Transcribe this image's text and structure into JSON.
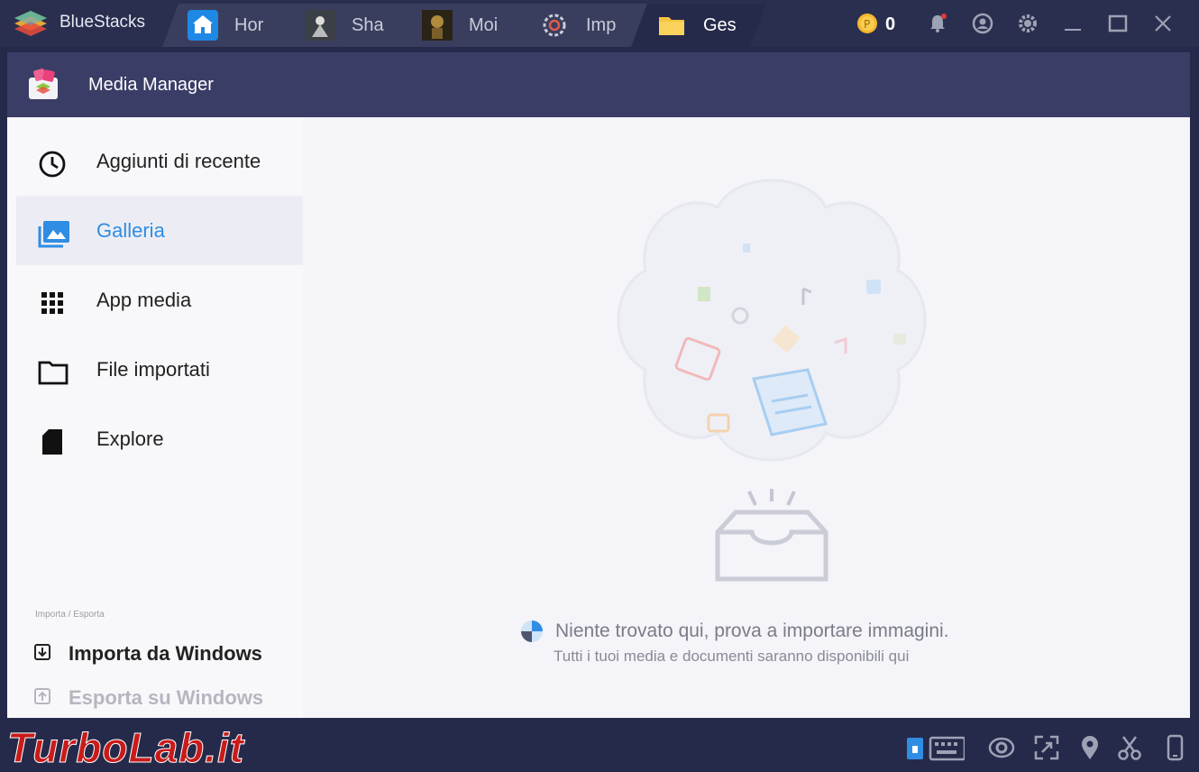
{
  "window": {
    "app_name": "BlueStacks",
    "coin_count": "0",
    "tabs": [
      {
        "label": "Hor",
        "icon": "home-icon"
      },
      {
        "label": "Sha",
        "icon": "game-icon"
      },
      {
        "label": "Moi",
        "icon": "game-icon"
      },
      {
        "label": "Imp",
        "icon": "settings-icon"
      },
      {
        "label": "Ges",
        "icon": "folder-icon"
      }
    ]
  },
  "header": {
    "title": "Media Manager"
  },
  "sidebar": {
    "items": [
      {
        "label": "Aggiunti di recente",
        "icon": "clock-icon"
      },
      {
        "label": "Galleria",
        "icon": "gallery-icon"
      },
      {
        "label": "App media",
        "icon": "grid-icon"
      },
      {
        "label": "File importati",
        "icon": "folder-icon"
      },
      {
        "label": "Explore",
        "icon": "sd-card-icon"
      }
    ],
    "import_export_caption": "Importa / Esporta",
    "import_label": "Importa da Windows",
    "export_label": "Esporta su Windows"
  },
  "main": {
    "empty_message": "Niente trovato qui, prova a importare immagini.",
    "empty_submessage": "Tutti i tuoi media e documenti saranno disponibili qui"
  },
  "watermark": "TurboLab.it",
  "colors": {
    "accent": "#2f8de4",
    "titlebar": "#2b2f4f",
    "header": "#3a3d66"
  }
}
